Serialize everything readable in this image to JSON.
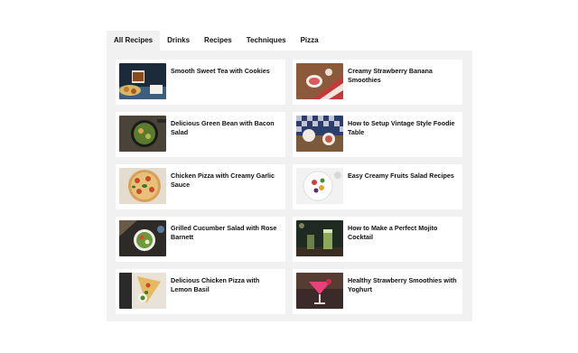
{
  "tabs": [
    {
      "label": "All Recipes",
      "active": true
    },
    {
      "label": "Drinks",
      "active": false
    },
    {
      "label": "Recipes",
      "active": false
    },
    {
      "label": "Techniques",
      "active": false
    },
    {
      "label": "Pizza",
      "active": false
    }
  ],
  "posts": [
    {
      "title": "Smooth Sweet Tea with Cookies",
      "thumb": "tea-cookies-image"
    },
    {
      "title": "Creamy Strawberry Banana Smoothies",
      "thumb": "strawberry-table-image"
    },
    {
      "title": "Delicious Green Bean with Bacon Salad",
      "thumb": "green-bean-pan-image"
    },
    {
      "title": "How to Setup Vintage Style Foodie Table",
      "thumb": "foodie-table-image"
    },
    {
      "title": "Chicken Pizza with Creamy Garlic Sauce",
      "thumb": "chicken-pizza-image"
    },
    {
      "title": "Easy Creamy Fruits Salad Recipes",
      "thumb": "fruit-salad-image"
    },
    {
      "title": "Grilled Cucumber Salad with Rose Barnett",
      "thumb": "cucumber-salad-image"
    },
    {
      "title": "How to Make a Perfect Mojito Cocktail",
      "thumb": "mojito-image"
    },
    {
      "title": "Delicious Chicken Pizza with Lemon Basil",
      "thumb": "pizza-slice-image"
    },
    {
      "title": "Healthy Strawberry Smoothies with Yoghurt",
      "thumb": "pink-cocktail-image"
    }
  ]
}
